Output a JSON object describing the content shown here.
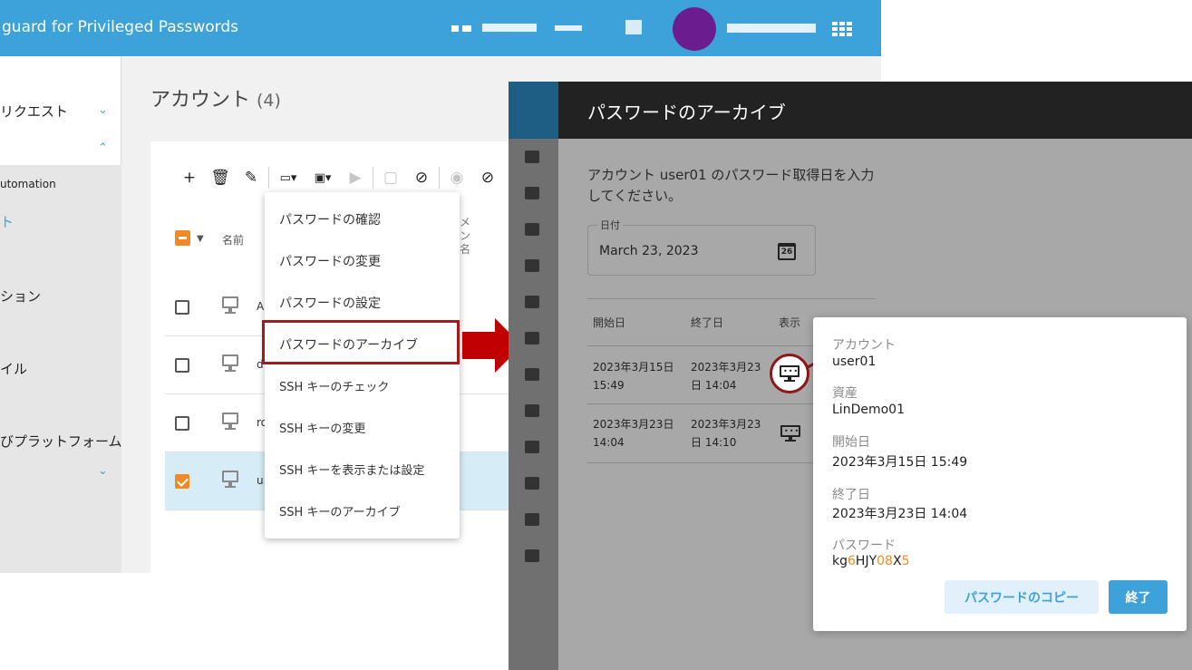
{
  "app": {
    "title": "guard for Privileged Passwords",
    "accent_color": "#3ea2da"
  },
  "sidebar": {
    "items": [
      {
        "label": "リクエスト"
      },
      {
        "label": "utomation"
      },
      {
        "label": "ト"
      },
      {
        "label": "ション"
      },
      {
        "label": "イル"
      },
      {
        "label": "びプラットフォーム"
      }
    ]
  },
  "page": {
    "title": "アカウント",
    "count": "(4)"
  },
  "toolbar": {
    "icons": [
      "add-icon",
      "delete-icon",
      "edit-icon",
      "password-menu-icon",
      "ssh-menu-icon",
      "play-icon",
      "stop-icon",
      "block-icon",
      "show-icon",
      "hide-icon"
    ]
  },
  "table": {
    "col_name": "名前",
    "col_extra": "メン名",
    "rows": [
      {
        "name": "A",
        "checked": false
      },
      {
        "name": "d",
        "checked": false
      },
      {
        "name": "ro",
        "checked": false
      },
      {
        "name": "u",
        "checked": true
      }
    ]
  },
  "menu": {
    "items": [
      "パスワードの確認",
      "パスワードの変更",
      "パスワードの設定",
      "パスワードのアーカイブ",
      "SSH キーのチェック",
      "SSH キーの変更",
      "SSH キーを表示または設定",
      "SSH キーのアーカイブ"
    ],
    "highlighted_index": 3
  },
  "dialog": {
    "title": "パスワードのアーカイブ",
    "prompt": "アカウント user01 のパスワード取得日を入力してください。",
    "date_label": "日付",
    "date_value": "March 23, 2023",
    "calendar_day": "26",
    "headers": {
      "start": "開始日",
      "end": "終了日",
      "show": "表示"
    },
    "rows": [
      {
        "start": "2023年3月15日 15:49",
        "end": "2023年3月23日 14:04"
      },
      {
        "start": "2023年3月23日 14:04",
        "end": "2023年3月23日 14:10"
      }
    ]
  },
  "popup": {
    "account_label": "アカウント",
    "account_value": "user01",
    "asset_label": "資産",
    "asset_value": "LinDemo01",
    "start_label": "開始日",
    "start_value": "2023年3月15日 15:49",
    "end_label": "終了日",
    "end_value": "2023年3月23日 14:04",
    "password_label": "パスワード",
    "password_parts": [
      "kg",
      "6",
      "HJY",
      "08",
      "X",
      "5"
    ],
    "copy_button": "パスワードのコピー",
    "close_button": "終了",
    "digit_color": "#f08a24"
  }
}
